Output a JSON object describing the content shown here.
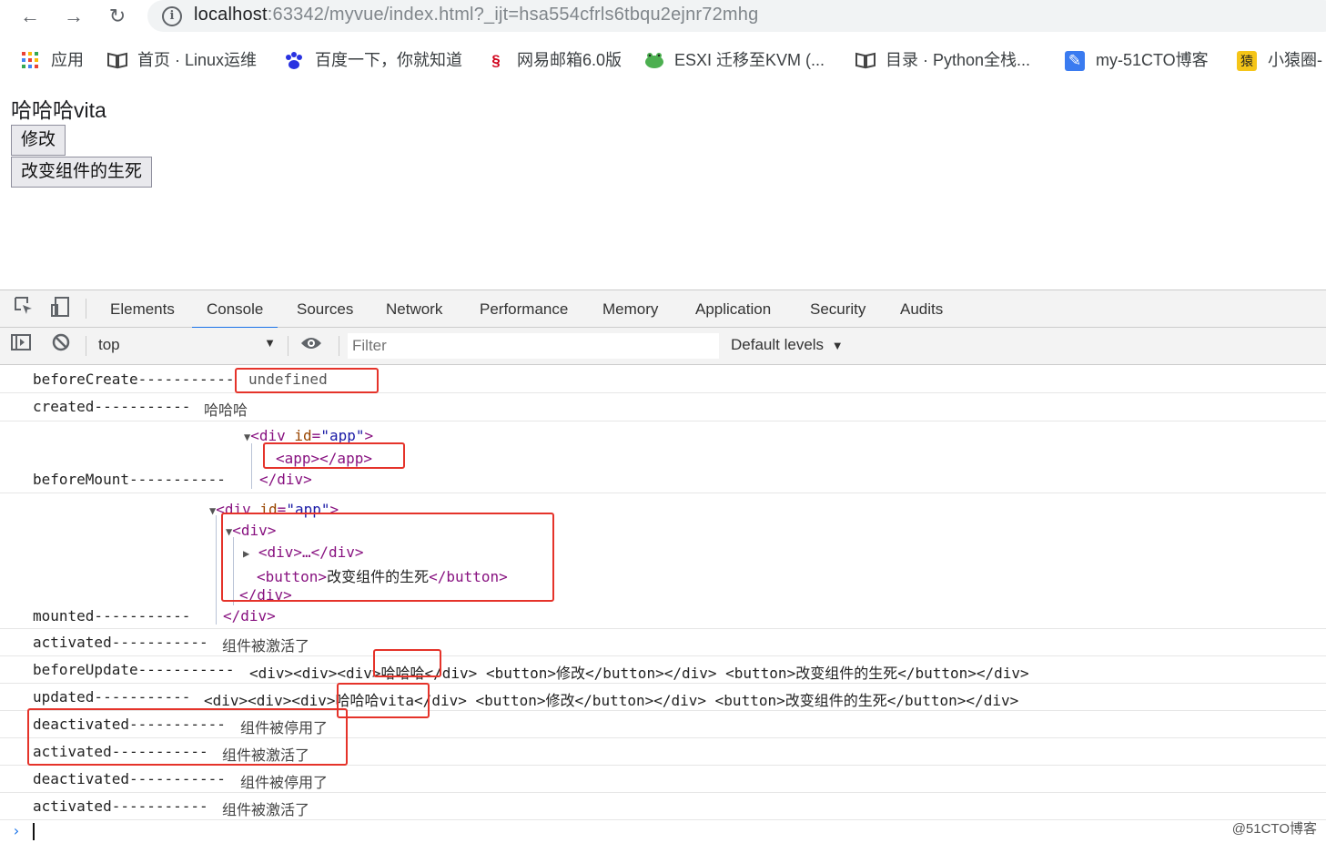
{
  "browser": {
    "url_host": "localhost",
    "url_rest": ":63342/myvue/index.html?_ijt=hsa554cfrls6tbqu2ejnr72mhg",
    "bookmarks": [
      {
        "icon": "apps-grid-icon",
        "label": "应用"
      },
      {
        "icon": "book-icon",
        "label": "首页 · Linux运维"
      },
      {
        "icon": "paw-icon",
        "label": "百度一下，你就知道"
      },
      {
        "icon": "netease-icon",
        "label": "网易邮箱6.0版"
      },
      {
        "icon": "frog-icon",
        "label": "ESXI 迁移至KVM (..."
      },
      {
        "icon": "book-icon",
        "label": "目录 · Python全栈..."
      },
      {
        "icon": "feather-icon",
        "label": "my-51CTO博客"
      },
      {
        "icon": "ape-icon",
        "label": "小猿圈-"
      }
    ]
  },
  "page": {
    "message": "哈哈哈vita",
    "edit_button": "修改",
    "toggle_button": "改变组件的生死"
  },
  "devtools": {
    "tabs": [
      "Elements",
      "Console",
      "Sources",
      "Network",
      "Performance",
      "Memory",
      "Application",
      "Security",
      "Audits"
    ],
    "active_tab": "Console",
    "context": "top",
    "filter_placeholder": "Filter",
    "levels": "Default levels"
  },
  "console": {
    "beforeCreate_label": "beforeCreate-----------",
    "beforeCreate_value": "undefined",
    "created_label": "created-----------",
    "created_value": "哈哈哈",
    "beforeMount_label": "beforeMount-----------",
    "mounted_label": "mounted-----------",
    "activated_label": "activated-----------",
    "activated_value": "组件被激活了",
    "beforeUpdate_label": "beforeUpdate-----------",
    "beforeUpdate_html_a": "<div><div><div>",
    "beforeUpdate_html_b": "哈哈哈",
    "beforeUpdate_html_c": "</div> <button>修改</button></div> <button>改变组件的生死</button></div>",
    "updated_label": "updated-----------",
    "updated_html_a": "<div><div><div>",
    "updated_html_b": "哈哈哈vita",
    "updated_html_c": "</div> <button>修改</button></div> <button>改变组件的生死</button></div>",
    "deactivated_label": "deactivated-----------",
    "deactivated_value": "组件被停用了",
    "dom": {
      "tag_open": "<div",
      "attr_name": "id",
      "attr_value": "\"app\"",
      "gt": ">",
      "app_tag": "<app></app>",
      "div_close": "</div>",
      "div_open": "<div>",
      "collapsed_div": "<div>…</div>",
      "button_open": "<button>",
      "button_text": "改变组件的生死",
      "button_close": "</button>"
    }
  },
  "watermark": "@51CTO博客",
  "colors": {
    "highlight_box": "#e5332a",
    "active_tab_underline": "#1a73e8",
    "tag": "#881280",
    "attr": "#994500",
    "attr_value": "#1a1aa6"
  }
}
